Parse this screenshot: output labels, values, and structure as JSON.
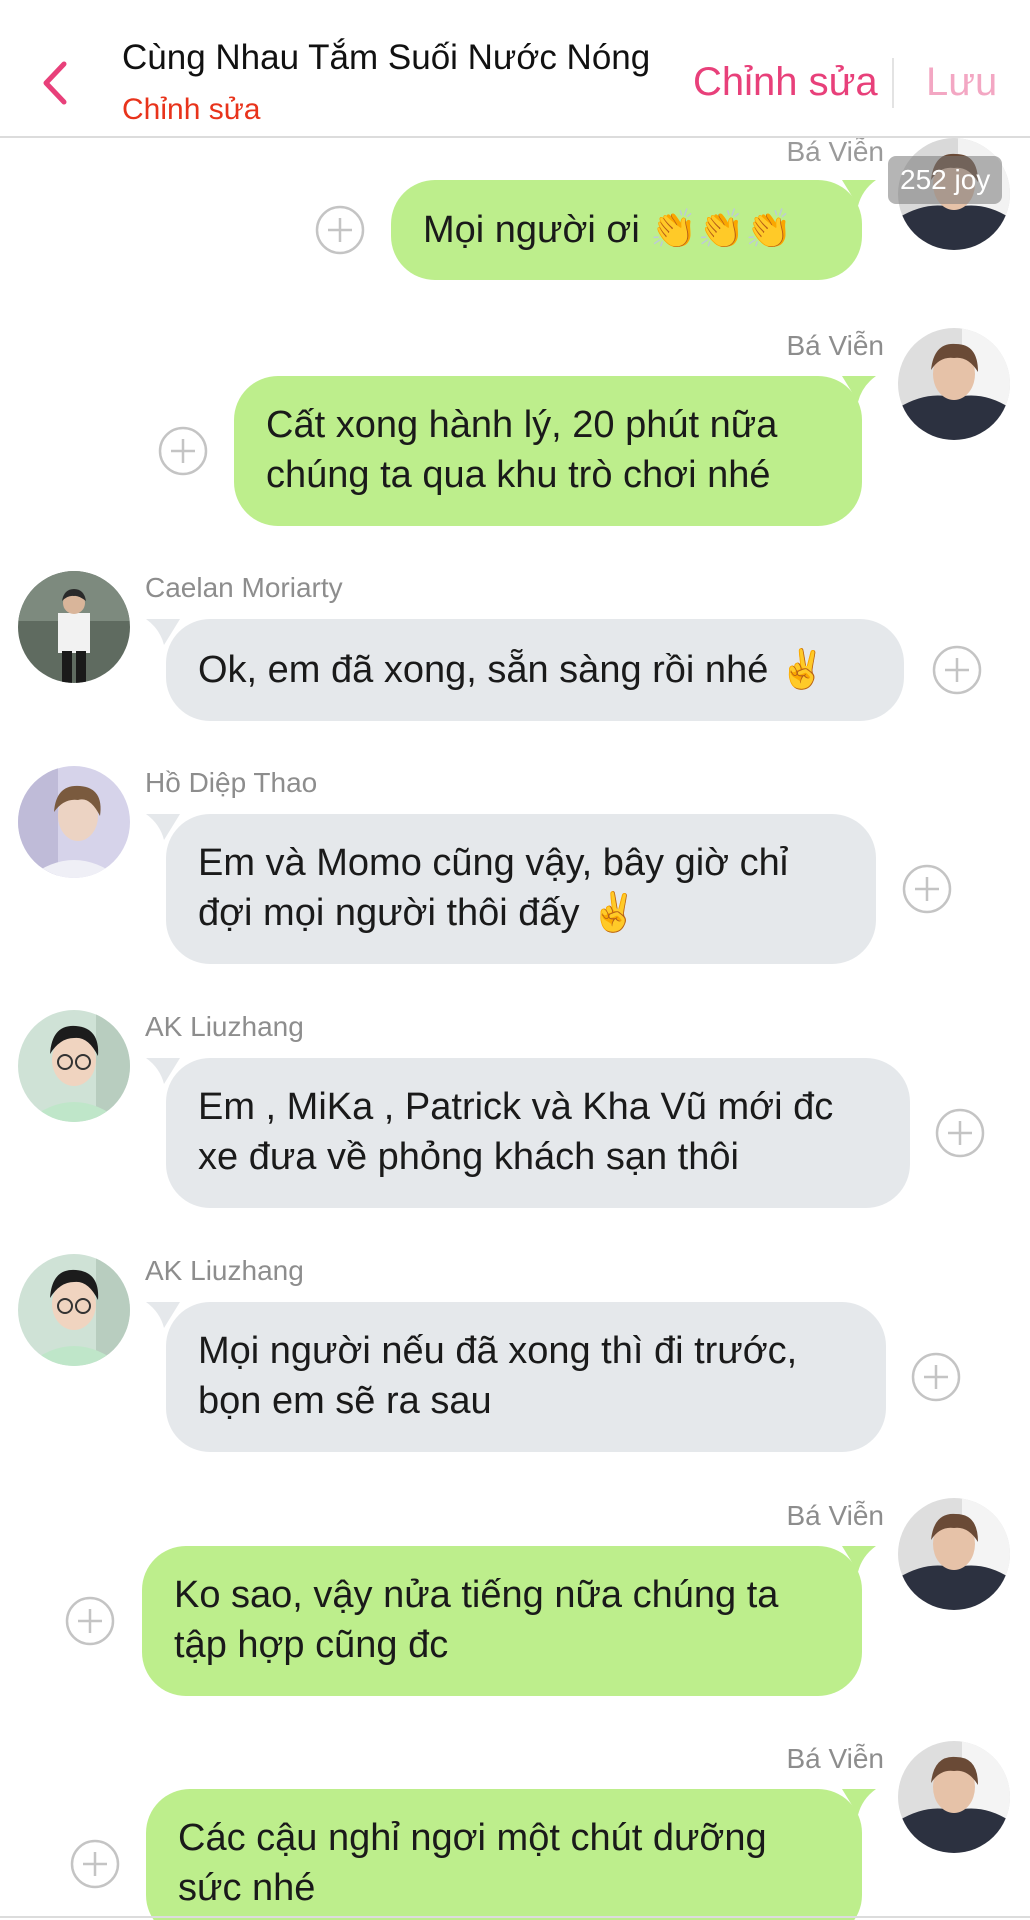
{
  "header": {
    "title": "Cùng Nhau Tắm Suối Nước Nóng",
    "subtitle": "Chỉnh sửa",
    "edit_label": "Chỉnh sửa",
    "save_label": "Lưu"
  },
  "colors": {
    "accent": "#e8407a",
    "accent_light": "#f3a7c3",
    "subtitle": "#e8331b",
    "outgoing_bubble": "#bdee8c",
    "incoming_bubble": "#e5e8eb",
    "sender_name": "#8d8d8d"
  },
  "badge": {
    "text": "252 joy"
  },
  "messages": [
    {
      "sender": "Bá Viễn",
      "direction": "out",
      "lines": [
        "Mọi người ơi 👏👏👏"
      ]
    },
    {
      "sender": "Bá Viễn",
      "direction": "out",
      "lines": [
        "Cất xong hành lý, 20 phút nữa",
        "chúng ta qua khu trò chơi nhé"
      ]
    },
    {
      "sender": "Caelan Moriarty",
      "direction": "in",
      "lines": [
        "Ok, em đã xong, sẵn sàng rồi nhé ✌️"
      ]
    },
    {
      "sender": "Hồ Diệp Thao",
      "direction": "in",
      "lines": [
        "Em và Momo cũng vậy, bây giờ chỉ",
        "đợi mọi người thôi đấy ✌️"
      ]
    },
    {
      "sender": "AK Liuzhang",
      "direction": "in",
      "lines": [
        "Em , MiKa , Patrick và Kha Vũ mới đc",
        "xe đưa về phỏng khách sạn thôi"
      ]
    },
    {
      "sender": "AK Liuzhang",
      "direction": "in",
      "lines": [
        "Mọi người nếu đã xong thì đi trước,",
        "bọn em sẽ ra sau"
      ]
    },
    {
      "sender": "Bá Viễn",
      "direction": "out",
      "lines": [
        "Ko sao, vậy nửa tiếng nữa chúng ta",
        "tập hợp cũng đc"
      ]
    },
    {
      "sender": "Bá Viễn",
      "direction": "out",
      "lines": [
        "Các cậu nghỉ ngơi một chút dưỡng",
        "sức nhé"
      ]
    }
  ]
}
